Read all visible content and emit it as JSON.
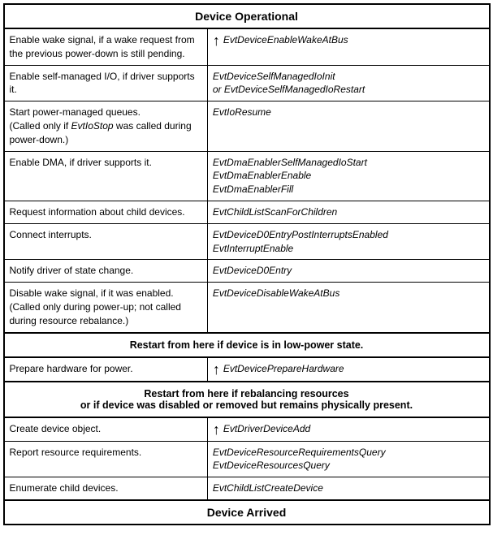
{
  "header": {
    "top_title": "Device Operational",
    "bottom_title": "Device Arrived"
  },
  "rows": [
    {
      "left": "Enable wake signal, if a wake request from the previous power-down is still pending.",
      "right": "EvtDeviceEnableWakeAtBus",
      "has_arrow": true
    },
    {
      "left": "Enable self-managed I/O, if driver supports it.",
      "right": "EvtDeviceSelfManagedIoInit\nor EvtDeviceSelfManagedIoRestart",
      "has_arrow": false
    },
    {
      "left": "Start power-managed queues.\n(Called only if EvtIoStop was called during power-down.)",
      "right": "EvtIoResume",
      "has_arrow": false
    },
    {
      "left": "Enable DMA, if driver supports it.",
      "right": "EvtDmaEnablerSelfManagedIoStart\nEvtDmaEnablerEnable\nEvtDmaEnablerFill",
      "has_arrow": false
    },
    {
      "left": "Request information about child devices.",
      "right": "EvtChildListScanForChildren",
      "has_arrow": false
    },
    {
      "left": "Connect interrupts.",
      "right": "EvtDeviceD0EntryPostInterruptsEnabled\nEvtInterruptEnable",
      "has_arrow": false
    },
    {
      "left": "Notify driver of state change.",
      "right": "EvtDeviceD0Entry",
      "has_arrow": false
    },
    {
      "left": "Disable wake signal, if it was enabled.\n(Called only during power-up; not called during resource rebalance.)",
      "right": "EvtDeviceDisableWakeAtBus",
      "has_arrow": false
    }
  ],
  "separator1": "Restart from here if device is in low-power state.",
  "middle_rows": [
    {
      "left": "Prepare hardware for power.",
      "right": "EvtDevicePrepareHardware",
      "has_arrow": true
    }
  ],
  "separator2": "Restart from here if rebalancing resources\nor if device was disabled or removed but remains physically present.",
  "bottom_rows": [
    {
      "left": "Create device object.",
      "right": "EvtDriverDeviceAdd",
      "has_arrow": true
    },
    {
      "left": "Report resource requirements.",
      "right": "EvtDeviceResourceRequirementsQuery\nEvtDeviceResourcesQuery",
      "has_arrow": false
    },
    {
      "left": "Enumerate child devices.",
      "right": "EvtChildListCreateDevice",
      "has_arrow": false
    }
  ]
}
